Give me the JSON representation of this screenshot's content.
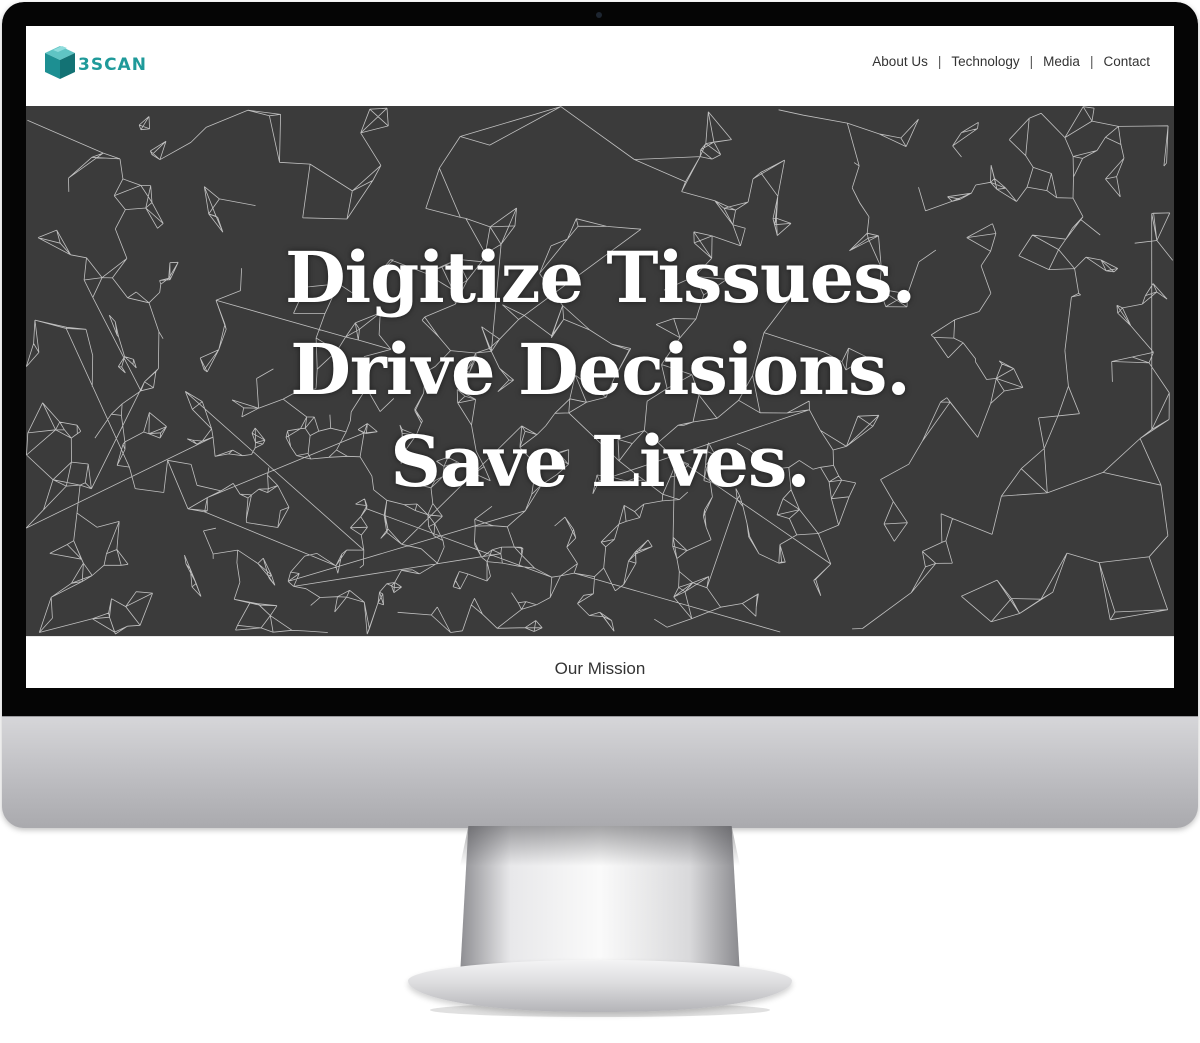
{
  "site": {
    "logo_text": "3SCAN",
    "nav": [
      {
        "label": "About Us"
      },
      {
        "label": "Technology"
      },
      {
        "label": "Media"
      },
      {
        "label": "Contact"
      }
    ],
    "nav_separator": "|"
  },
  "hero": {
    "lines": [
      "Digitize Tissues.",
      "Drive Decisions.",
      "Save Lives."
    ],
    "background_color": "#3b3b3b",
    "line_color": "#d8d8d8"
  },
  "mission": {
    "label": "Our Mission"
  },
  "colors": {
    "brand_teal": "#1f9a9a",
    "bezel": "#050505",
    "aluminum": "#c4c4c8"
  },
  "icons": {
    "logo": "cube-logo-icon"
  }
}
